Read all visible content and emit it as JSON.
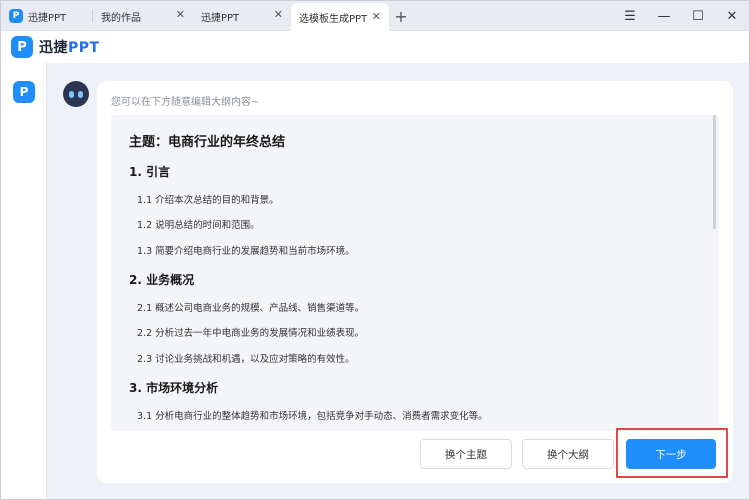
{
  "tabs": [
    {
      "label": "迅捷PPT",
      "has_logo": true
    },
    {
      "label": "我的作品",
      "closable": true
    },
    {
      "label": "迅捷PPT",
      "closable": true
    },
    {
      "label": "选模板生成PPT",
      "closable": true,
      "active": true
    }
  ],
  "tab_add": "+",
  "window_controls": {
    "menu": "☰",
    "minimize": "—",
    "maximize": "☐",
    "close": "✕"
  },
  "app": {
    "logo_glyph": "P",
    "name_prefix": "迅捷",
    "name_suffix": "PPT"
  },
  "card": {
    "hint": "您可以在下方随意编辑大纲内容~",
    "title": "主题：电商行业的年终总结",
    "sections": [
      {
        "heading": "1. 引言",
        "items": [
          "1.1 介绍本次总结的目的和背景。",
          "1.2 说明总结的时间和范围。",
          "1.3 简要介绍电商行业的发展趋势和当前市场环境。"
        ]
      },
      {
        "heading": "2. 业务概况",
        "items": [
          "2.1 概述公司电商业务的规模、产品线、销售渠道等。",
          "2.2 分析过去一年中电商业务的发展情况和业绩表现。",
          "2.3 讨论业务挑战和机遇，以及应对策略的有效性。"
        ]
      },
      {
        "heading": "3. 市场环境分析",
        "items": [
          "3.1 分析电商行业的整体趋势和市场环境，包括竞争对手动态、消费者需求变化等。"
        ]
      }
    ]
  },
  "buttons": {
    "change_theme": "换个主题",
    "change_outline": "换个大纲",
    "next": "下一步"
  },
  "colors": {
    "accent": "#1f8efb",
    "highlight": "#e04848"
  }
}
